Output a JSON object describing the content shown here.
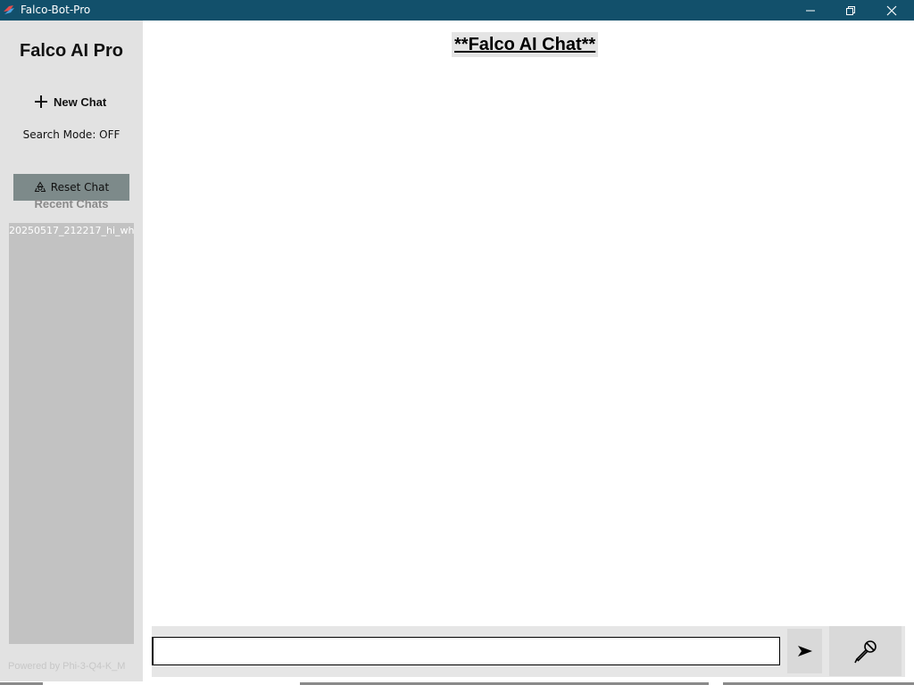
{
  "window": {
    "title": "Falco-Bot-Pro",
    "colors": {
      "titlebar": "#12506b",
      "sidebar": "#e2e2e2",
      "reset_button": "#7d8a8a",
      "recent_list": "#c2c2c2"
    }
  },
  "sidebar": {
    "brand": "Falco AI Pro",
    "new_chat_label": "New Chat",
    "new_chat_icon": "plus-icon",
    "search_mode": "Search Mode: OFF",
    "reset_chat_label": "Reset Chat",
    "reset_chat_icon": "recycle-icon",
    "recent_heading": "Recent Chats",
    "recent_chats": [
      "20250517_212217_hi_wh"
    ],
    "powered_by": "Powered by Phi-3-Q4-K_M"
  },
  "main": {
    "title": "**Falco AI Chat**",
    "input_value": "",
    "send_icon": "send-arrow-icon",
    "mic_icon": "microphone-icon"
  }
}
